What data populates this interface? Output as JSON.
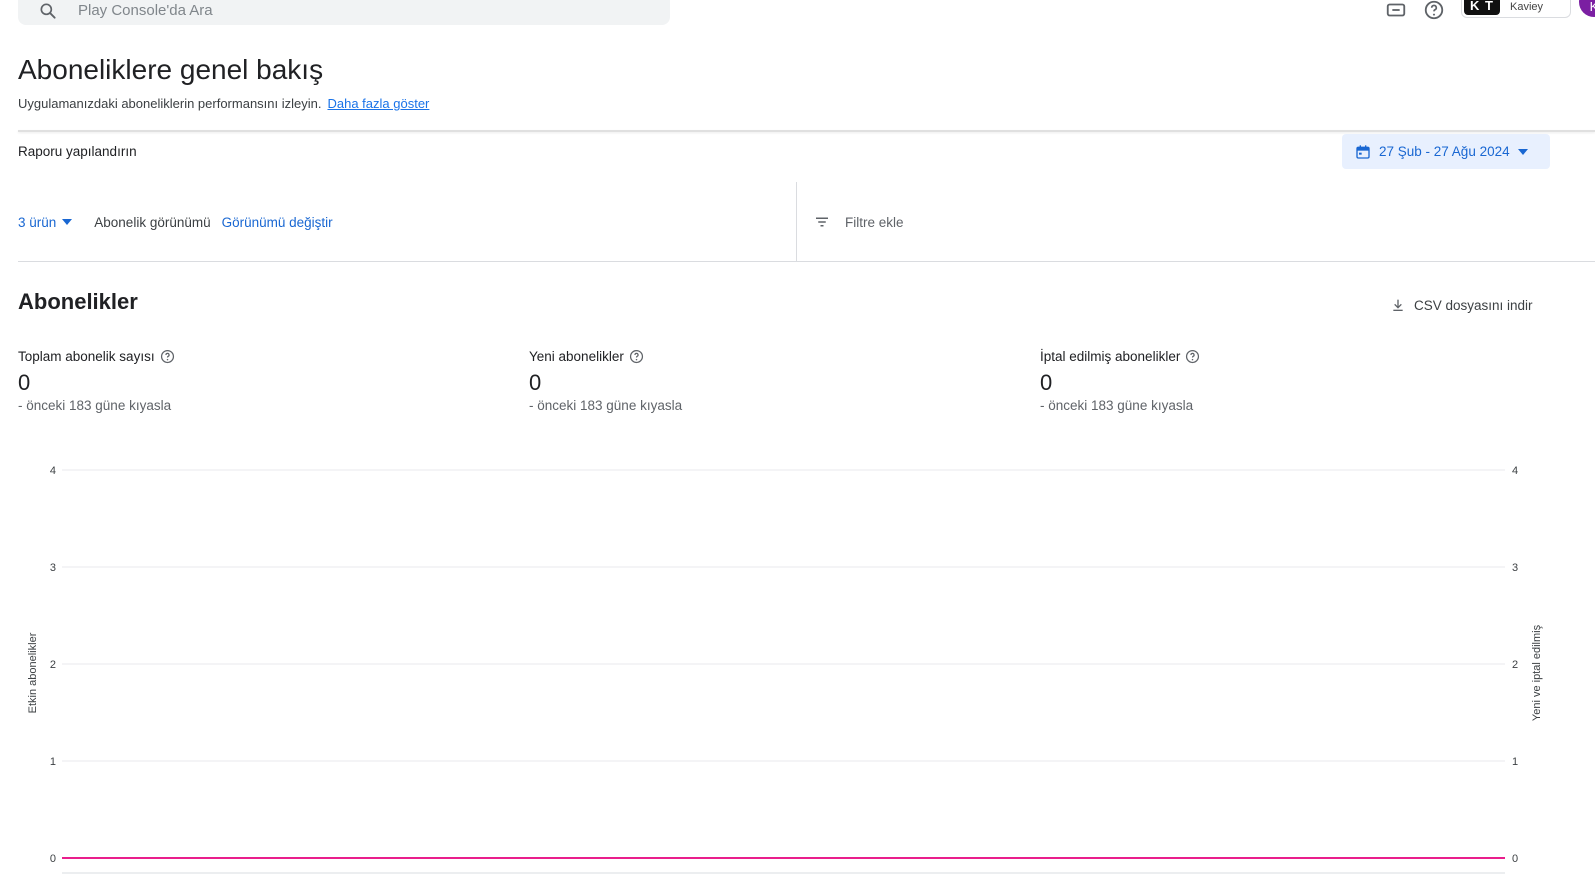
{
  "header": {
    "search_placeholder": "Play Console'da Ara",
    "account_logo_text": "K T",
    "account_name": "Kaviey",
    "avatar_initial": "K"
  },
  "page": {
    "title": "Aboneliklere genel bakış",
    "subtitle": "Uygulamanızdaki aboneliklerin performansını izleyin.",
    "show_more_link": "Daha fazla göster"
  },
  "report": {
    "config_label": "Raporu yapılandırın",
    "date_range": "27 Şub - 27 Ağu 2024",
    "products_label": "3 ürün",
    "view_label": "Abonelik görünümü",
    "change_view_link": "Görünümü değiştir",
    "add_filter_label": "Filtre ekle"
  },
  "section": {
    "title": "Abonelikler",
    "csv_button": "CSV dosyasını indir"
  },
  "metrics": [
    {
      "label": "Toplam abonelik sayısı",
      "value": "0",
      "compare": "- önceki 183 güne kıyasla"
    },
    {
      "label": "Yeni abonelikler",
      "value": "0",
      "compare": "- önceki 183 güne kıyasla"
    },
    {
      "label": "İptal edilmiş abonelikler",
      "value": "0",
      "compare": "- önceki 183 güne kıyasla"
    }
  ],
  "colors": {
    "accent": "#1967d2",
    "series_line": "#e91e8c",
    "grid": "#e8eaed"
  },
  "chart_data": {
    "type": "line",
    "ylabel": "Etkin abonelikler",
    "y2label": "Yeni ve iptal edilmiş",
    "ylim": [
      0,
      4
    ],
    "y2lim": [
      0,
      4
    ],
    "yticks": [
      "0",
      "1",
      "2",
      "3",
      "4"
    ],
    "y2ticks": [
      "0",
      "1",
      "2",
      "3",
      "4"
    ],
    "grid": true,
    "series": [
      {
        "values": [
          0,
          0
        ]
      }
    ]
  }
}
